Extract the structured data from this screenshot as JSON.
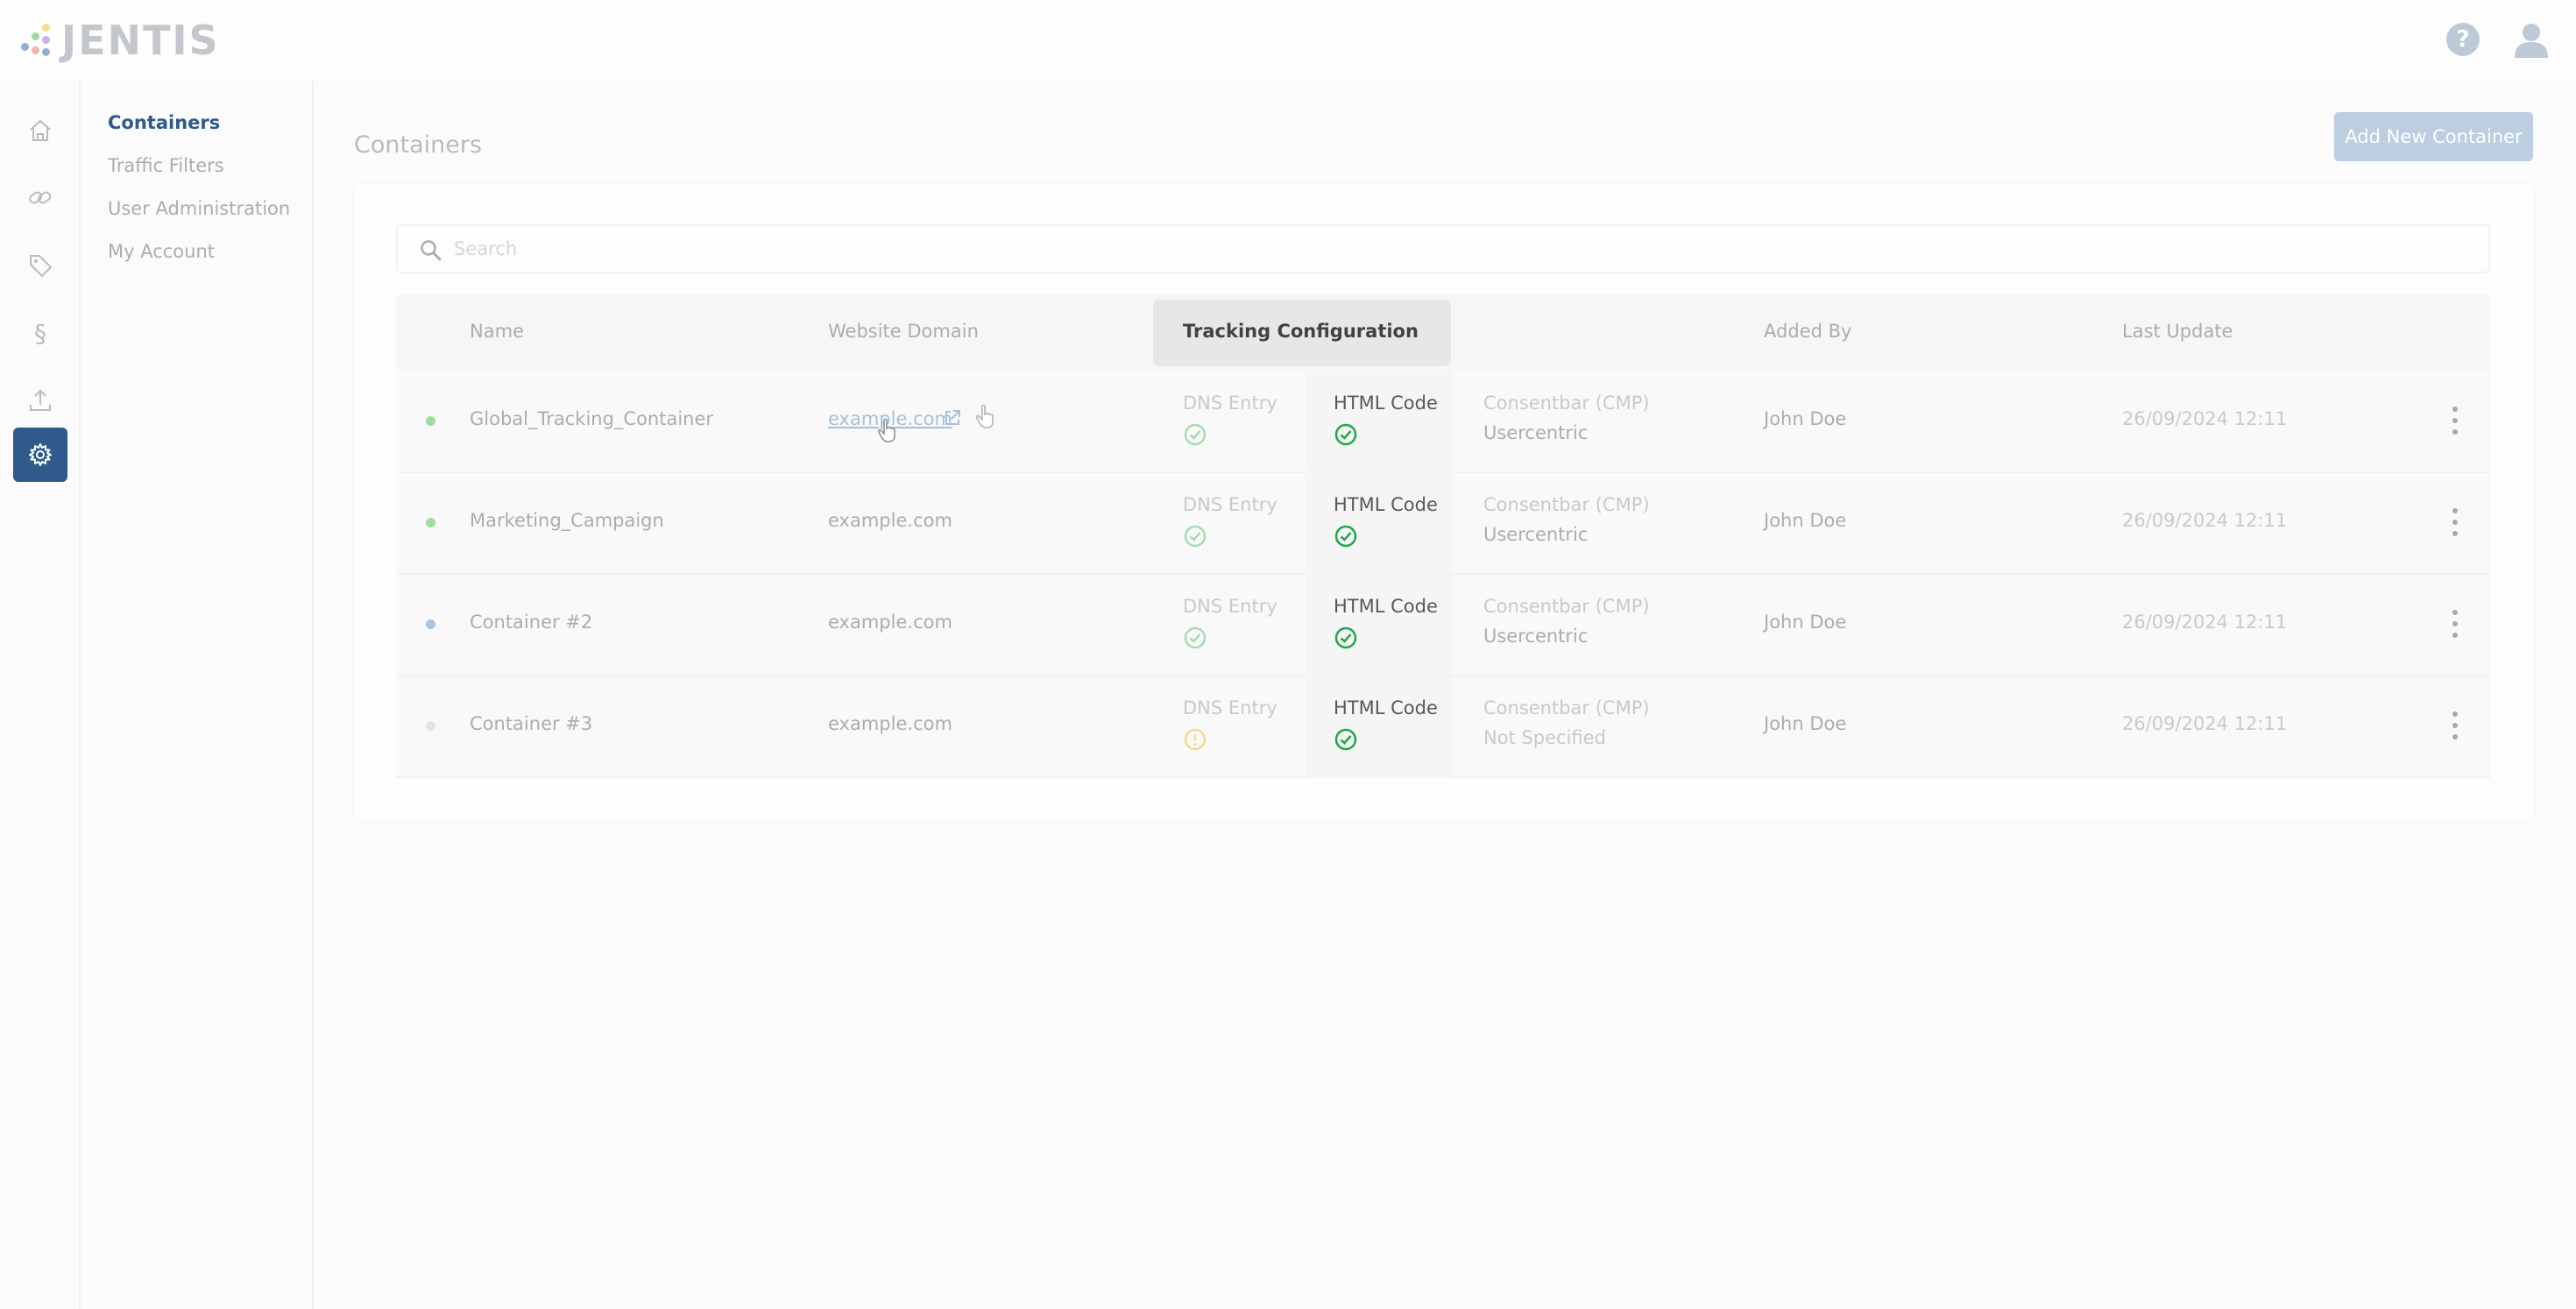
{
  "app": {
    "logo_text": "JENTIS"
  },
  "header": {
    "help_glyph": "?"
  },
  "rail": {
    "items": [
      {
        "icon": "home-icon"
      },
      {
        "icon": "link-icon"
      },
      {
        "icon": "tag-icon"
      },
      {
        "icon": "section-icon",
        "glyph": "§"
      },
      {
        "icon": "upload-icon"
      },
      {
        "icon": "gear-icon",
        "active": true
      }
    ]
  },
  "subnav": {
    "items": [
      {
        "label": "Containers",
        "active": true
      },
      {
        "label": "Traffic Filters"
      },
      {
        "label": "User Administration"
      },
      {
        "label": "My Account"
      }
    ]
  },
  "main": {
    "title": "Containers",
    "add_button": "Add New Container",
    "search_placeholder": "Search"
  },
  "table": {
    "headers": {
      "name": "Name",
      "domain": "Website Domain",
      "tracking": "Tracking Configuration",
      "added_by": "Added By",
      "last_update": "Last Update"
    },
    "rows": [
      {
        "status_color": "#9fdc9f",
        "name": "Global_Tracking_Container",
        "domain": "example.com",
        "dns": "DNS Entry",
        "dns_state": "ok",
        "html": "HTML Code",
        "cmp": "Consentbar (CMP)",
        "cmp_value": "Usercentric",
        "added_by": "John Doe",
        "last_update": "26/09/2024 12:11"
      },
      {
        "status_color": "#9fdc9f",
        "name": "Marketing_Campaign",
        "domain": "example.com",
        "dns": "DNS Entry",
        "dns_state": "ok",
        "html": "HTML Code",
        "cmp": "Consentbar (CMP)",
        "cmp_value": "Usercentric",
        "added_by": "John Doe",
        "last_update": "26/09/2024 12:11"
      },
      {
        "status_color": "#a9c6e6",
        "name": "Container #2",
        "domain": "example.com",
        "dns": "DNS Entry",
        "dns_state": "ok",
        "html": "HTML Code",
        "cmp": "Consentbar (CMP)",
        "cmp_value": "Usercentric",
        "added_by": "John Doe",
        "last_update": "26/09/2024 12:11"
      },
      {
        "status_color": "#e3e3e3",
        "name": "Container #3",
        "domain": "example.com",
        "dns": "DNS Entry",
        "dns_state": "warning",
        "html": "HTML Code",
        "cmp": "Consentbar (CMP)",
        "cmp_value": "Not Specified",
        "added_by": "John Doe",
        "last_update": "26/09/2024 12:11"
      }
    ]
  },
  "colors": {
    "accent": "#2f5a8c",
    "check_ok": "#1fa84a",
    "check_ok_faded": "#a6dcb3",
    "warning_faded": "#f3dc8a",
    "add_button_bg": "#bccedf"
  }
}
